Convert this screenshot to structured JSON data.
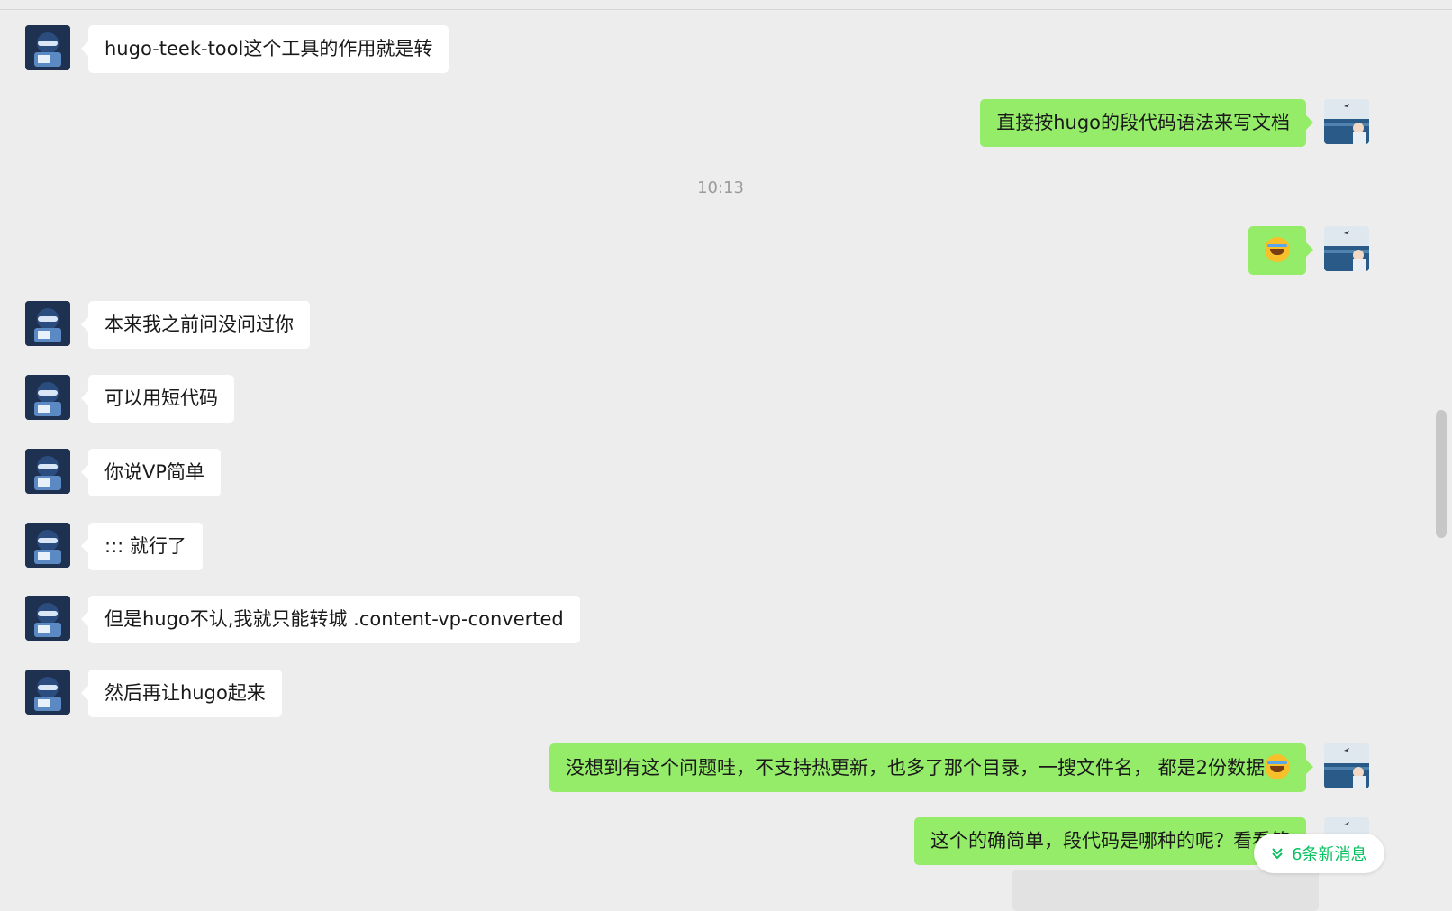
{
  "conversation": {
    "timestamp": "10:13",
    "messages": [
      {
        "id": "m1",
        "side": "left",
        "text": "hugo-teek-tool这个工具的作用就是转"
      },
      {
        "id": "m2",
        "side": "right",
        "text": "直接按hugo的段代码语法来写文档"
      },
      {
        "id": "m3",
        "side": "right",
        "text": "",
        "emoji": "laughing-crying-emoji"
      },
      {
        "id": "m4",
        "side": "left",
        "text": "本来我之前问没问过你"
      },
      {
        "id": "m5",
        "side": "left",
        "text": "可以用短代码"
      },
      {
        "id": "m6",
        "side": "left",
        "text": "你说VP简单"
      },
      {
        "id": "m7",
        "side": "left",
        "text": "::: 就行了"
      },
      {
        "id": "m8",
        "side": "left",
        "text": "但是hugo不认,我就只能转城 .content-vp-converted"
      },
      {
        "id": "m9",
        "side": "left",
        "text": "然后再让hugo起来"
      },
      {
        "id": "m10",
        "side": "right",
        "text": "没想到有这个问题哇，不支持热更新，也多了那个目录，一搜文件名， 都是2份数据",
        "emoji": "laughing-crying-emoji"
      },
      {
        "id": "m11",
        "side": "right",
        "text": "这个的确简单，段代码是哪种的呢？看看简"
      }
    ]
  },
  "new_messages_pill": {
    "label": "6条新消息",
    "icon": "double-chevron-down-icon"
  },
  "colors": {
    "background": "#ededed",
    "incoming_bubble": "#ffffff",
    "outgoing_bubble": "#95ec69",
    "accent": "#07c160"
  }
}
